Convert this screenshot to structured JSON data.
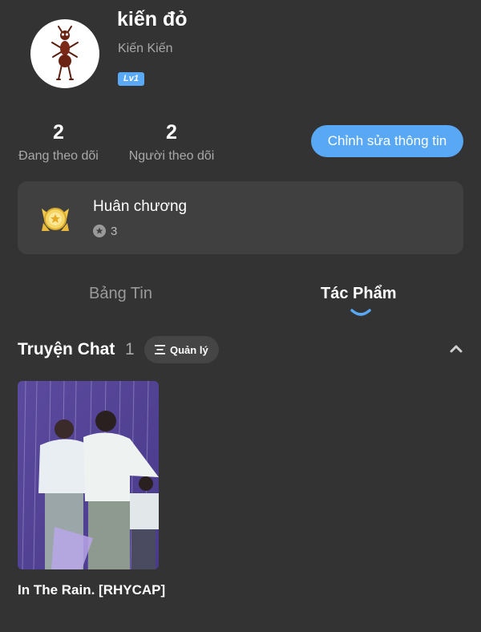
{
  "profile": {
    "display_name": "kiến đỏ",
    "username": "Kiến Kiến",
    "level": "Lv1",
    "avatar_icon": "ant-icon"
  },
  "stats": {
    "following": {
      "value": "2",
      "label": "Đang theo dõi"
    },
    "followers": {
      "value": "2",
      "label": "Người theo dõi"
    }
  },
  "edit_button": "Chỉnh sửa thông tin",
  "medals": {
    "title": "Huân chương",
    "count": "3",
    "icon": "medal-icon"
  },
  "tabs": [
    {
      "label": "Bảng Tin",
      "active": false
    },
    {
      "label": "Tác Phẩm",
      "active": true
    }
  ],
  "section": {
    "title": "Truyện Chat",
    "count": "1",
    "manage_label": "Quản lý"
  },
  "stories": [
    {
      "title": "In The Rain. [RHYCAP]"
    }
  ],
  "colors": {
    "background": "#333333",
    "card": "#404040",
    "accent": "#58a8f5",
    "muted_text": "#a8a8a8"
  }
}
